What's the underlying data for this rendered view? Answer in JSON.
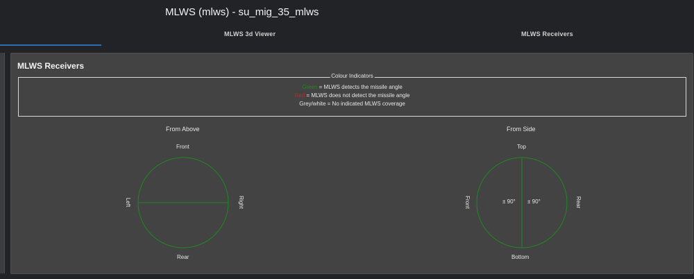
{
  "header": {
    "title": "MLWS (mlws) - su_mig_35_mlws",
    "tabs": [
      {
        "label": "MLWS 3d Viewer"
      },
      {
        "label": "MLWS Receivers"
      }
    ]
  },
  "panel": {
    "title": "MLWS Receivers",
    "legend": {
      "caption": "Colour Indicators",
      "green_word": "Green",
      "green_text": " = MLWS detects the missile angle",
      "red_word": "Red",
      "red_text": " = MLWS does not detect the missile angle",
      "grey_text": "Grey/white = No indicated MLWS coverage"
    },
    "views": {
      "above": {
        "title": "From Above",
        "top_label": "Front",
        "bottom_label": "Rear",
        "left_label": "Left",
        "right_label": "Right"
      },
      "side": {
        "title": "From Side",
        "top_label": "Top",
        "bottom_label": "Bottom",
        "left_label": "Front",
        "right_label": "Rear",
        "left_angle": "± 90°",
        "right_angle": "± 90°"
      }
    }
  },
  "colors": {
    "coverage_green": "#1f8a1f",
    "tab_accent": "#2e6fb0",
    "panel_bg": "#434343"
  }
}
